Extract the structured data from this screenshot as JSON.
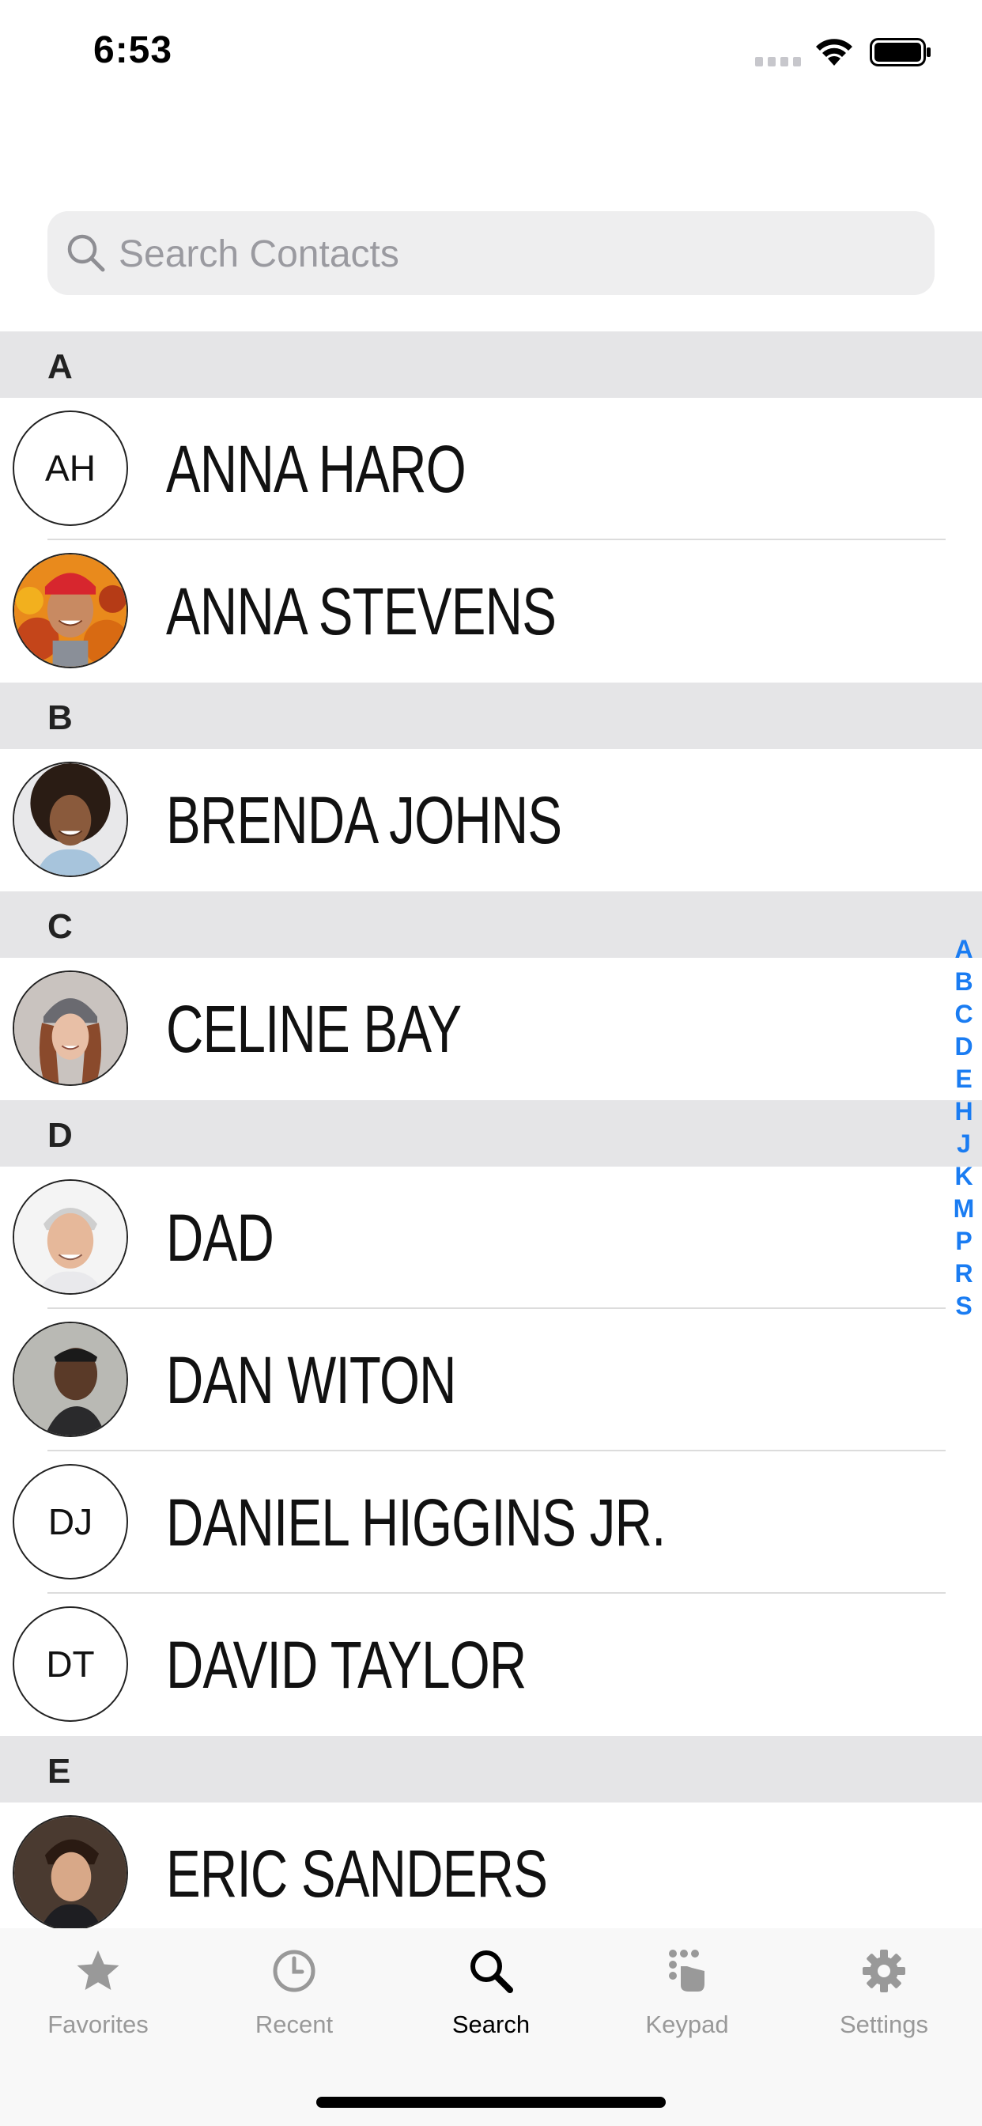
{
  "status_bar": {
    "time": "6:53"
  },
  "search": {
    "placeholder": "Search Contacts",
    "value": ""
  },
  "sections": [
    {
      "letter": "A",
      "contacts": [
        {
          "name": "ANNA HARO",
          "initials": "AH",
          "photo": false
        },
        {
          "name": "ANNA STEVENS",
          "initials": "",
          "photo": true
        }
      ]
    },
    {
      "letter": "B",
      "contacts": [
        {
          "name": "BRENDA JOHNS",
          "initials": "",
          "photo": true
        }
      ]
    },
    {
      "letter": "C",
      "contacts": [
        {
          "name": "CELINE BAY",
          "initials": "",
          "photo": true
        }
      ]
    },
    {
      "letter": "D",
      "contacts": [
        {
          "name": "DAD",
          "initials": "",
          "photo": true
        },
        {
          "name": "DAN WITON",
          "initials": "",
          "photo": true
        },
        {
          "name": "DANIEL HIGGINS JR.",
          "initials": "DJ",
          "photo": false
        },
        {
          "name": "DAVID TAYLOR",
          "initials": "DT",
          "photo": false
        }
      ]
    },
    {
      "letter": "E",
      "contacts": [
        {
          "name": "ERIC SANDERS",
          "initials": "",
          "photo": true
        }
      ]
    }
  ],
  "alpha_index": [
    "A",
    "B",
    "C",
    "D",
    "E",
    "H",
    "J",
    "K",
    "M",
    "P",
    "R",
    "S"
  ],
  "tabs": [
    {
      "label": "Favorites",
      "icon": "star-icon",
      "active": false
    },
    {
      "label": "Recent",
      "icon": "clock-icon",
      "active": false
    },
    {
      "label": "Search",
      "icon": "search-icon",
      "active": true
    },
    {
      "label": "Keypad",
      "icon": "keypad-icon",
      "active": false
    },
    {
      "label": "Settings",
      "icon": "gear-icon",
      "active": false
    }
  ],
  "colors": {
    "accent": "#1a7cf2",
    "section_bg": "#e5e5e7",
    "tab_inactive": "#999999"
  }
}
